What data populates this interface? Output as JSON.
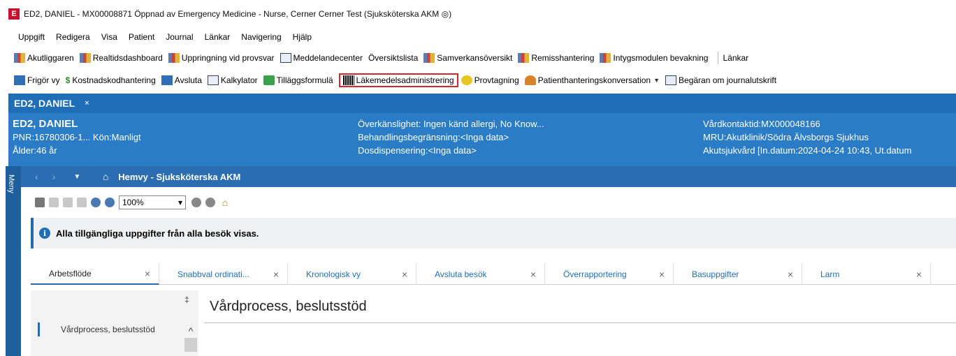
{
  "window": {
    "app_icon": "E",
    "title": "ED2, DANIEL - MX00008871 Öppnad av Emergency Medicine - Nurse, Cerner Cerner Test (Sjuksköterska AKM ◎)"
  },
  "menu": [
    "Uppgift",
    "Redigera",
    "Visa",
    "Patient",
    "Journal",
    "Länkar",
    "Navigering",
    "Hjälp"
  ],
  "toolbar1": {
    "items": [
      "Akutliggaren",
      "Realtidsdashboard",
      "Uppringning vid provsvar",
      "Meddelandecenter",
      "Översiktslista",
      "Samverkansöversikt",
      "Remisshantering",
      "Intygsmodulen bevakning"
    ],
    "links_label": "Länkar"
  },
  "toolbar2": {
    "items": [
      "Frigör vy",
      "Kostnadskodhantering",
      "Avsluta",
      "Kalkylator",
      "Tilläggsformulä",
      "Läkemedelsadministrering",
      "Provtagning",
      "Patienthanteringskonversation",
      "Begäran om journalutskrift"
    ],
    "highlighted": "Läkemedelsadministrering",
    "money_symbol": "$"
  },
  "patient_tab": {
    "label": "ED2, DANIEL",
    "close": "×"
  },
  "banner": {
    "name": "ED2, DANIEL",
    "pnr": "PNR:16780306-1...",
    "gender": "Kön:Manligt",
    "age": "Ålder:46 år",
    "allergy": "Överkänslighet: Ingen känd allergi, No Know...",
    "treatment_limit": "Behandlingsbegränsning:<Inga data>",
    "dose_dispensing": "Dosdispensering:<Inga data>",
    "contact_id": "Vårdkontaktid:MX000048166",
    "mru": "MRU:Akutklinik/Södra Älvsborgs Sjukhus",
    "care_type": "Akutsjukvård [In.datum:2024-04-24 10:43, Ut.datum"
  },
  "meny_label": "Meny",
  "navbar": {
    "back": "‹",
    "forward": "›",
    "dropdown": "▼",
    "title": "Hemvy - Sjuksköterska AKM"
  },
  "view_toolbar": {
    "zoom": "100%",
    "zoom_arrow": "▾"
  },
  "info_bar": {
    "icon": "i",
    "text": "Alla tillgängliga uppgifter från alla besök visas."
  },
  "tabs": [
    "Arbetsflöde",
    "Snabbval ordinati...",
    "Kronologisk vy",
    "Avsluta besök",
    "Överrapportering",
    "Basuppgifter",
    "Larm"
  ],
  "tab_close": "×",
  "side": {
    "pin": "‡",
    "item": "Vårdprocess, beslutsstöd",
    "scroll_up": "^"
  },
  "main": {
    "heading": "Vårdprocess, beslutsstöd"
  }
}
